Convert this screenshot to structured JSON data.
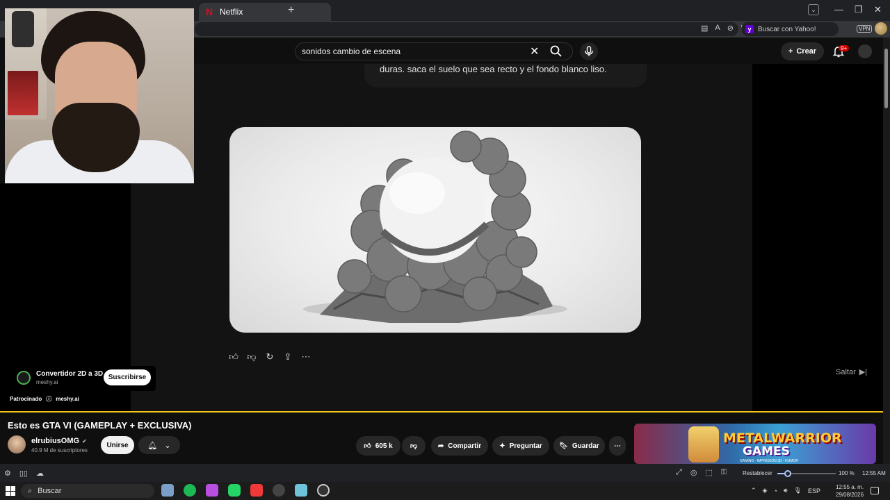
{
  "browser": {
    "active_tab": "Netflix",
    "new_tab_symbol": "+",
    "search_box": "Buscar con Yahoo!",
    "vpn": "VPN"
  },
  "youtube": {
    "search_query": "sonidos cambio de escena",
    "create_label": "Crear",
    "notifications_badge": "9+"
  },
  "ad": {
    "prompt_text": "duras. saca el suelo que sea recto y el fondo blanco liso.",
    "skip_label": "Saltar",
    "sponsor_name": "Convertidor 2D a 3D",
    "sponsor_url": "meshy.ai",
    "subscribe_label": "Suscribirse",
    "sponsored_label": "Patrocinado",
    "sponsored_domain": "meshy.ai"
  },
  "video": {
    "title": "Esto es GTA VI (GAMEPLAY + EXCLUSIVA)",
    "channel_name": "elrubiusOMG",
    "subscribers": "40.9 M de suscriptores",
    "join_label": "Unirse",
    "likes": "605 k",
    "share_label": "Compartir",
    "ask_label": "Preguntar",
    "save_label": "Guardar"
  },
  "banner": {
    "line1": "METALWARRIOR",
    "line2": "GAMES",
    "line3": "GAMING - IMPRESIÓN 3D - HUMOR"
  },
  "statusbar": {
    "reset_label": "Restablecer",
    "zoom": "100 %",
    "zoom_fraction": 0.18,
    "time": "12:55 AM"
  },
  "taskbar": {
    "search_label": "Buscar",
    "language": "ESP",
    "clock_time": "12:55 a. m.",
    "clock_date": "29/08/2026"
  },
  "colors": {
    "progress": "#f5c518",
    "youtube_bg": "#0f0f0f",
    "taskbar": "#1c1c1c"
  }
}
